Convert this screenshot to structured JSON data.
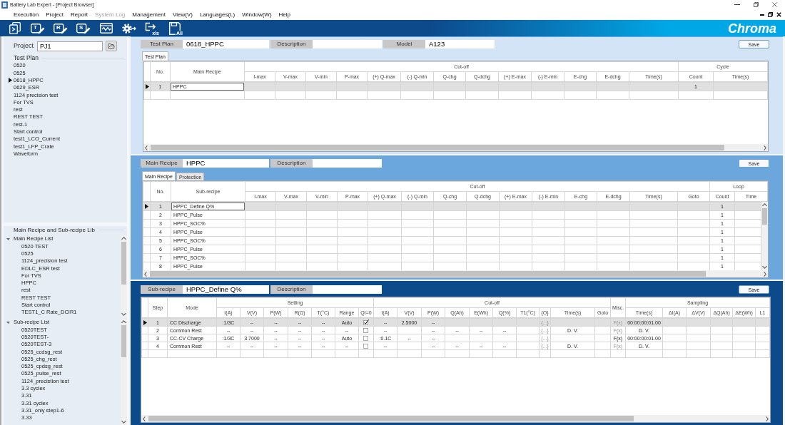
{
  "window": {
    "title": "Battery Lab Expert - [Project Browser]"
  },
  "menu": [
    {
      "label": "Execution",
      "disabled": false
    },
    {
      "label": "Project",
      "disabled": false
    },
    {
      "label": "Report",
      "disabled": false
    },
    {
      "label": "System Log",
      "disabled": true
    },
    {
      "label": "Management",
      "disabled": false
    },
    {
      "label": "View(V)",
      "disabled": false
    },
    {
      "label": "Languages(L)",
      "disabled": false
    },
    {
      "label": "Window(W)",
      "disabled": false
    },
    {
      "label": "Help",
      "disabled": false
    }
  ],
  "toolbar": {
    "buttons": [
      {
        "kind": "run"
      },
      {
        "kind": "edit",
        "glyph": "T"
      },
      {
        "kind": "edit",
        "glyph": "R"
      },
      {
        "kind": "edit",
        "glyph": "S"
      },
      {
        "kind": "waveform"
      },
      {
        "kind": "settings"
      },
      {
        "kind": "export",
        "glyph": "xls"
      },
      {
        "kind": "save_all",
        "glyph": "All"
      }
    ],
    "logo": "Chroma"
  },
  "sidebar": {
    "project": {
      "label": "Project",
      "value": "PJ1"
    },
    "test_plan": {
      "title": "Test Plan",
      "items": [
        {
          "label": "0520",
          "selected": false
        },
        {
          "label": "0525",
          "selected": false
        },
        {
          "label": "0618_HPPC",
          "selected": true
        },
        {
          "label": "0629_ESR",
          "selected": false
        },
        {
          "label": "1124 precision test",
          "selected": false
        },
        {
          "label": "For TVS",
          "selected": false
        },
        {
          "label": "rest",
          "selected": false
        },
        {
          "label": "REST TEST",
          "selected": false
        },
        {
          "label": "rest-1",
          "selected": false
        },
        {
          "label": "Start control",
          "selected": false
        },
        {
          "label": "test1_LCO_Current",
          "selected": false
        },
        {
          "label": "test1_LFP_Crate",
          "selected": false
        },
        {
          "label": "Waveform",
          "selected": false
        }
      ]
    },
    "library": {
      "title": "Main Recipe and Sub-recipe Lib",
      "groups": [
        {
          "label": "Main Recipe List",
          "expanded": true,
          "children": [
            {
              "label": "0520 TEST"
            },
            {
              "label": "0525"
            },
            {
              "label": "1124_precision test"
            },
            {
              "label": "EDLC_ESR test"
            },
            {
              "label": "For TVS"
            },
            {
              "label": "HPPC"
            },
            {
              "label": "rest"
            },
            {
              "label": "REST TEST"
            },
            {
              "label": "Start control"
            },
            {
              "label": "TEST1_C Rate_DCIR1"
            }
          ]
        },
        {
          "label": "Sub-recipe List",
          "expanded": true,
          "children": [
            {
              "label": "0520TEST"
            },
            {
              "label": "0520TEST-"
            },
            {
              "label": "0520TEST-3"
            },
            {
              "label": "0525_ccdsg_rest"
            },
            {
              "label": "0525_chg_rest"
            },
            {
              "label": "0525_cpdsg_rest"
            },
            {
              "label": "0525_pulse_rest"
            },
            {
              "label": "1124_precistion test"
            },
            {
              "label": "3.3 cyclex"
            },
            {
              "label": "3.31"
            },
            {
              "label": "3.31 cyclex"
            },
            {
              "label": "3.31_only step1-6"
            },
            {
              "label": "3.33"
            }
          ]
        }
      ]
    }
  },
  "test_plan_panel": {
    "fields": [
      {
        "label": "Test Plan",
        "value": "0618_HPPC"
      },
      {
        "label": "Description"
      },
      {
        "label": "Model",
        "value": "A123"
      }
    ],
    "save": "Save",
    "tabs": [
      {
        "label": "Test Plan",
        "selected": true
      }
    ],
    "table": {
      "header": [
        {
          "label": "No."
        },
        {
          "label": "Main Recipe"
        },
        {
          "label": "Cut-off",
          "columns": [
            "I-max",
            "V-max",
            "V-min",
            "P-max",
            "(+) Q-max",
            "(-) Q-min",
            "Q-chg",
            "Q-dchg",
            "(+) E-max",
            "(-) E-min",
            "E-chg",
            "E-dchg",
            "Time(s)"
          ]
        },
        {
          "label": "Cycle",
          "columns": [
            "Count",
            "Time(s)"
          ]
        }
      ],
      "rows": [
        {
          "selected": true,
          "cells": [
            "1",
            {
              "kind": "editor",
              "text": "HPPC"
            },
            null,
            null,
            null,
            null,
            null,
            null,
            null,
            null,
            null,
            null,
            null,
            null,
            null,
            "1"
          ]
        }
      ]
    }
  },
  "main_recipe_panel": {
    "fields": [
      {
        "label": "Main Recipe",
        "value": "HPPC"
      },
      {
        "label": "Description"
      }
    ],
    "save": "Save",
    "tabs": [
      {
        "label": "Main Recipe",
        "selected": true
      },
      {
        "label": "Protection",
        "selected": false
      }
    ],
    "table": {
      "header": [
        {
          "label": "No."
        },
        {
          "label": "Sub-recipe"
        },
        {
          "label": "Cut-off",
          "columns": [
            "I-max",
            "V-max",
            "V-min",
            "P-max",
            "(+) Q-max",
            "(-) Q-min",
            "Q-chg",
            "Q-dchg",
            "(+) E-max",
            "(-) E-min",
            "E-chg",
            "E-dchg",
            "Time(s)",
            "Goto"
          ]
        },
        {
          "label": "Loop",
          "columns": [
            "Count",
            "Time"
          ]
        }
      ],
      "rows": [
        {
          "selected": true,
          "cells": [
            "1",
            {
              "kind": "editor",
              "text": "HPPC_Define Q%"
            },
            null,
            null,
            null,
            null,
            null,
            null,
            null,
            null,
            null,
            null,
            null,
            null,
            null,
            null,
            "1"
          ]
        },
        {
          "selected": false,
          "cells": [
            "2",
            "HPPC_Pulse",
            null,
            null,
            null,
            null,
            null,
            null,
            null,
            null,
            null,
            null,
            null,
            null,
            null,
            null,
            "1"
          ]
        },
        {
          "selected": false,
          "cells": [
            "3",
            "HPPC_SOC%",
            null,
            null,
            null,
            null,
            null,
            null,
            null,
            null,
            null,
            null,
            null,
            null,
            null,
            null,
            "1"
          ]
        },
        {
          "selected": false,
          "cells": [
            "4",
            "HPPC_Pulse",
            null,
            null,
            null,
            null,
            null,
            null,
            null,
            null,
            null,
            null,
            null,
            null,
            null,
            null,
            "1"
          ]
        },
        {
          "selected": false,
          "cells": [
            "5",
            "HPPC_SOC%",
            null,
            null,
            null,
            null,
            null,
            null,
            null,
            null,
            null,
            null,
            null,
            null,
            null,
            null,
            "1"
          ]
        },
        {
          "selected": false,
          "cells": [
            "6",
            "HPPC_Pulse",
            null,
            null,
            null,
            null,
            null,
            null,
            null,
            null,
            null,
            null,
            null,
            null,
            null,
            null,
            "1"
          ]
        },
        {
          "selected": false,
          "cells": [
            "7",
            "HPPC_SOC%",
            null,
            null,
            null,
            null,
            null,
            null,
            null,
            null,
            null,
            null,
            null,
            null,
            null,
            null,
            "1"
          ]
        },
        {
          "selected": false,
          "cells": [
            "8",
            "HPPC_Pulse",
            null,
            null,
            null,
            null,
            null,
            null,
            null,
            null,
            null,
            null,
            null,
            null,
            null,
            null,
            "1"
          ]
        }
      ]
    }
  },
  "sub_recipe_panel": {
    "fields": [
      {
        "label": "Sub-recipe",
        "value": "HPPC_Define Q%"
      },
      {
        "label": "Description"
      }
    ],
    "save": "Save",
    "table": {
      "header": [
        {
          "label": "Step"
        },
        {
          "label": "Mode"
        },
        {
          "label": "Setting",
          "columns": [
            "I(A)",
            "V(V)",
            "P(W)",
            "R(Ω)",
            "T(°C)",
            "Range",
            "Qt=0"
          ]
        },
        {
          "label": "Cut-off",
          "columns": [
            "I(A)",
            "V(V)",
            "P(W)",
            "Q(Ah)",
            "E(Wh)",
            "Q(%)",
            "T1(°C)",
            "{O}",
            "Time(s)",
            "Goto"
          ]
        },
        {
          "label": "Misc."
        },
        {
          "label": "Sampling",
          "columns": [
            "Time(s)",
            "ΔI(A)",
            "ΔV(V)",
            "ΔQ(Ah)",
            "ΔE(Wh)",
            "L1"
          ]
        }
      ],
      "rows": [
        {
          "selected": true,
          "cells": [
            "1",
            "CC Discharge",
            ":1/3C",
            "--",
            "--",
            "--",
            "--",
            "Auto",
            {
              "kind": "checkbox",
              "checked": true
            },
            "--",
            "2.5000",
            "--",
            null,
            null,
            null,
            null,
            {
              "kind": "button",
              "text": "{...}",
              "disabled": true
            },
            null,
            null,
            {
              "kind": "button",
              "text": "F(x)",
              "disabled": true
            },
            "00:00:00:01.00"
          ]
        },
        {
          "selected": false,
          "cells": [
            "2",
            "Common Rest",
            "--",
            "--",
            "--",
            "--",
            "--",
            "--",
            {
              "kind": "checkbox",
              "checked": false
            },
            "--",
            null,
            "--",
            "--",
            "--",
            "--",
            null,
            {
              "kind": "button",
              "text": "{...}",
              "disabled": true
            },
            "D. V.",
            null,
            {
              "kind": "button",
              "text": "F(x)",
              "disabled": true
            },
            "D. V."
          ]
        },
        {
          "selected": false,
          "cells": [
            "3",
            "CC-CV Charge",
            ":1/3C",
            "3.7000",
            "--",
            "--",
            "--",
            "Auto",
            {
              "kind": "checkbox",
              "checked": false
            },
            ":0.1C",
            "--",
            "--",
            null,
            null,
            null,
            null,
            {
              "kind": "button",
              "text": "{...}",
              "disabled": true
            },
            null,
            null,
            {
              "kind": "button",
              "text": "F(x)",
              "disabled": false
            },
            "00:00:00:01.00"
          ]
        },
        {
          "selected": false,
          "cells": [
            "4",
            "Common Rest",
            "--",
            "--",
            "--",
            "--",
            "--",
            "--",
            {
              "kind": "checkbox",
              "checked": false
            },
            "--",
            null,
            "--",
            "--",
            "--",
            "--",
            null,
            {
              "kind": "button",
              "text": "{...}",
              "disabled": true
            },
            "D. V.",
            null,
            {
              "kind": "button",
              "text": "F(x)",
              "disabled": true
            },
            "D. V."
          ]
        }
      ]
    }
  }
}
